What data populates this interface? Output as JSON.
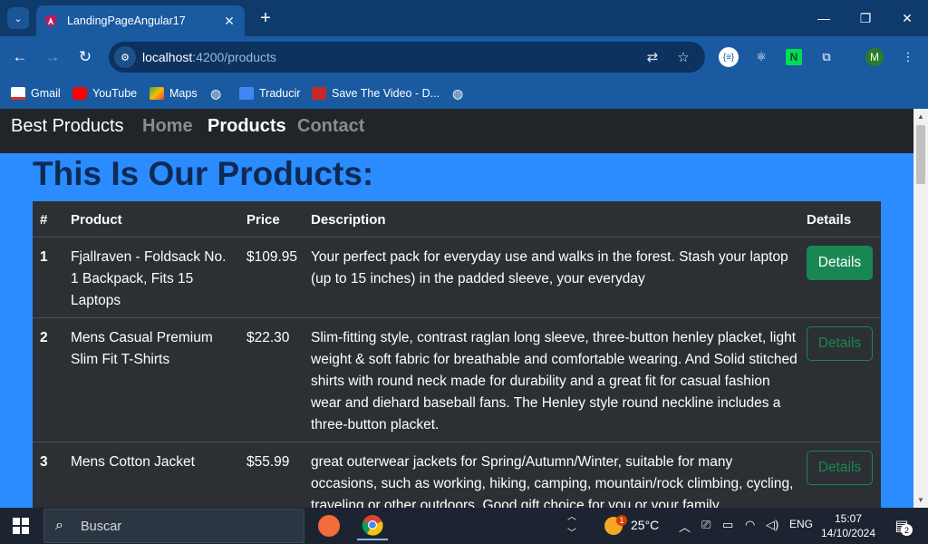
{
  "browser": {
    "tab_title": "LandingPageAngular17",
    "url_host": "localhost",
    "url_rest": ":4200/products",
    "bookmarks": [
      "Gmail",
      "YouTube",
      "Maps",
      "Traducir",
      "Save The Video - D..."
    ]
  },
  "page": {
    "brand": "Best Products",
    "nav": [
      "Home",
      "Products",
      "Contact"
    ],
    "active_nav": "Products",
    "heading": "This Is Our Products:",
    "table": {
      "headers": [
        "#",
        "Product",
        "Price",
        "Description",
        "Details"
      ],
      "rows": [
        {
          "num": "1",
          "product": "Fjallraven - Foldsack No. 1 Backpack, Fits 15 Laptops",
          "price": "$109.95",
          "description": "Your perfect pack for everyday use and walks in the forest. Stash your laptop (up to 15 inches) in the padded sleeve, your everyday",
          "button": "Details"
        },
        {
          "num": "2",
          "product": "Mens Casual Premium Slim Fit T-Shirts",
          "price": "$22.30",
          "description": "Slim-fitting style, contrast raglan long sleeve, three-button henley placket, light weight & soft fabric for breathable and comfortable wearing. And Solid stitched shirts with round neck made for durability and a great fit for casual fashion wear and diehard baseball fans. The Henley style round neckline includes a three-button placket.",
          "button": "Details"
        },
        {
          "num": "3",
          "product": "Mens Cotton Jacket",
          "price": "$55.99",
          "description": "great outerwear jackets for Spring/Autumn/Winter, suitable for many occasions, such as working, hiking, camping, mountain/rock climbing, cycling, traveling or other outdoors. Good gift choice for you or your family",
          "button": "Details"
        }
      ]
    }
  },
  "taskbar": {
    "search_placeholder": "Buscar",
    "weather": "25°C",
    "language": "ENG",
    "time": "15:07",
    "date": "14/10/2024",
    "notification_count": "2",
    "weather_badge": "1"
  },
  "colors": {
    "page_bg": "#2b8cff",
    "navbar_bg": "#212529",
    "table_bg": "#2c2f33",
    "success": "#198754",
    "heading": "#0d2a55"
  }
}
